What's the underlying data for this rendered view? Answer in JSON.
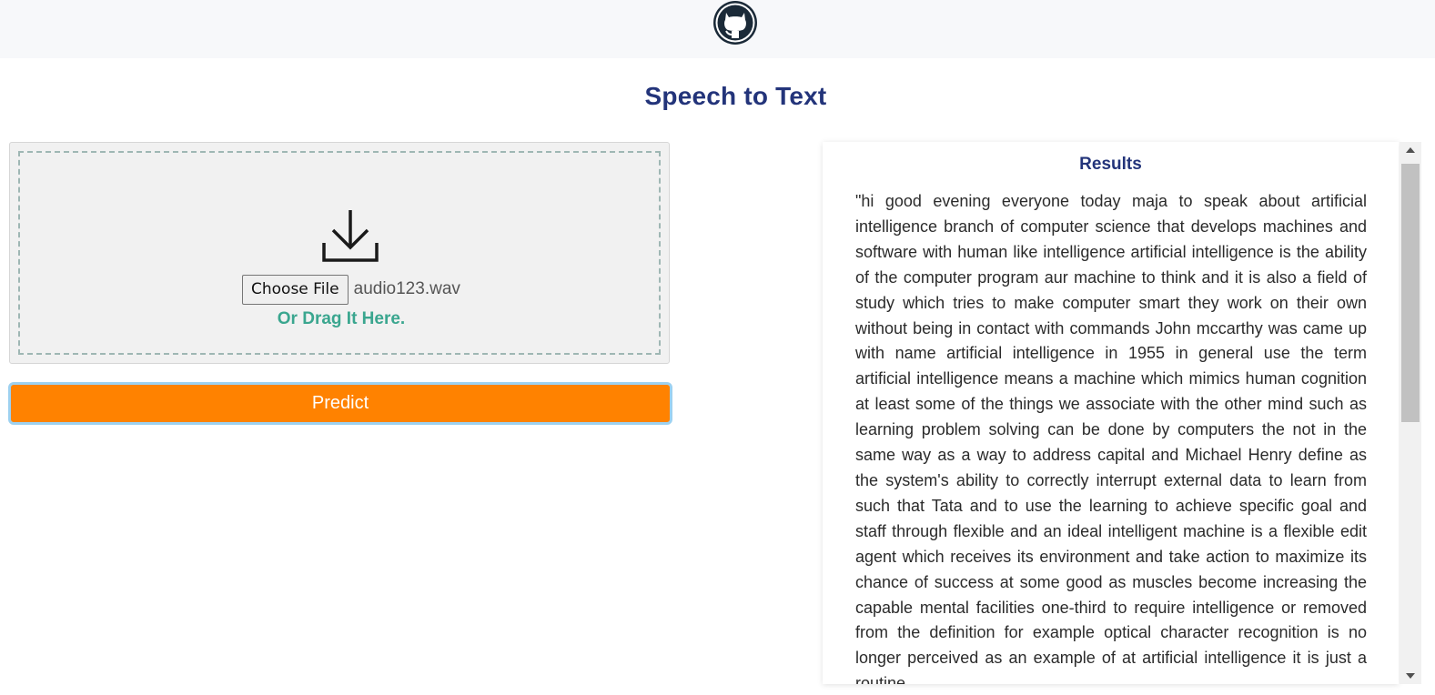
{
  "header": {
    "logo_icon": "github-icon"
  },
  "page": {
    "title": "Speech to Text"
  },
  "upload": {
    "icon": "download-icon",
    "choose_file_label": "Choose File",
    "file_name": "audio123.wav",
    "drag_text": "Or Drag It Here."
  },
  "actions": {
    "predict_label": "Predict"
  },
  "results": {
    "title": "Results",
    "text": "\"hi good evening everyone today maja to speak about artificial intelligence branch of computer science that develops machines and software with human like intelligence artificial intelligence is the ability of the computer program aur machine to think and it is also a field of study which tries to make computer smart they work on their own without being in contact with commands John mccarthy was came up with name artificial intelligence in 1955 in general use the term artificial intelligence means a machine which mimics human cognition at least some of the things we associate with the other mind such as learning problem solving can be done by computers the not in the same way as a way to address capital and Michael Henry define as the system's ability to correctly interrupt external data to learn from such that Tata and to use the learning to achieve specific goal and staff through flexible and an ideal intelligent machine is a flexible edit agent which receives its environment and take action to maximize its chance of success at some good as muscles become increasing the capable mental facilities one-third to require intelligence or removed from the definition for example optical character recognition is no longer perceived as an example of at artificial intelligence it is just a routine"
  },
  "colors": {
    "title": "#23347a",
    "accent_orange": "#ff8200",
    "drag_text": "#3aa68f",
    "topbar_bg": "#f7f8fa"
  }
}
